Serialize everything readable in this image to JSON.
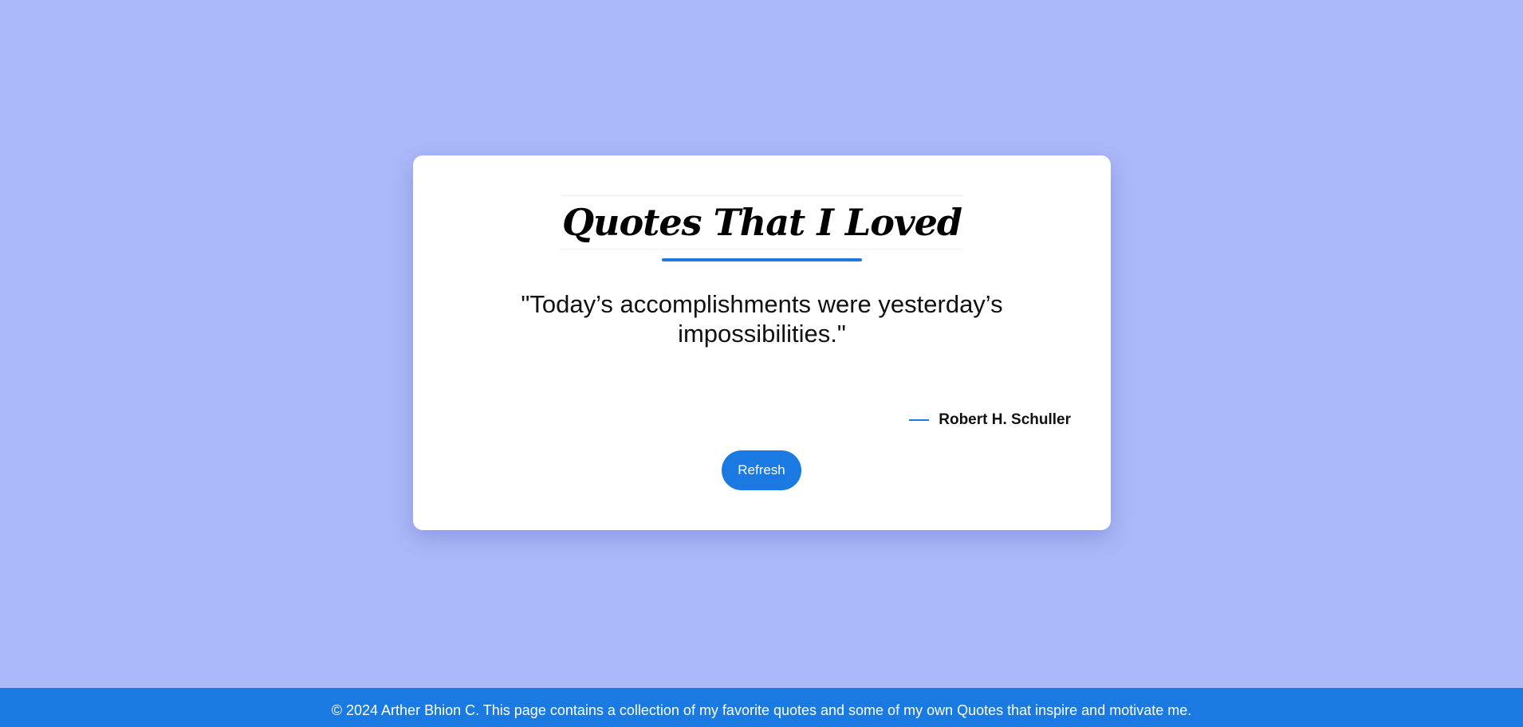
{
  "card": {
    "title": "Quotes That I Loved",
    "quote": "\"Today’s accomplishments were yesterday’s impossibilities.\"",
    "author": "Robert H. Schuller",
    "refresh_label": "Refresh"
  },
  "footer": {
    "text": "© 2024 Arther Bhion C. This page contains a collection of my favorite quotes and some of my own Quotes that inspire and motivate me."
  },
  "colors": {
    "background": "#abb8f9",
    "accent": "#1a7ae2",
    "card": "#ffffff"
  }
}
